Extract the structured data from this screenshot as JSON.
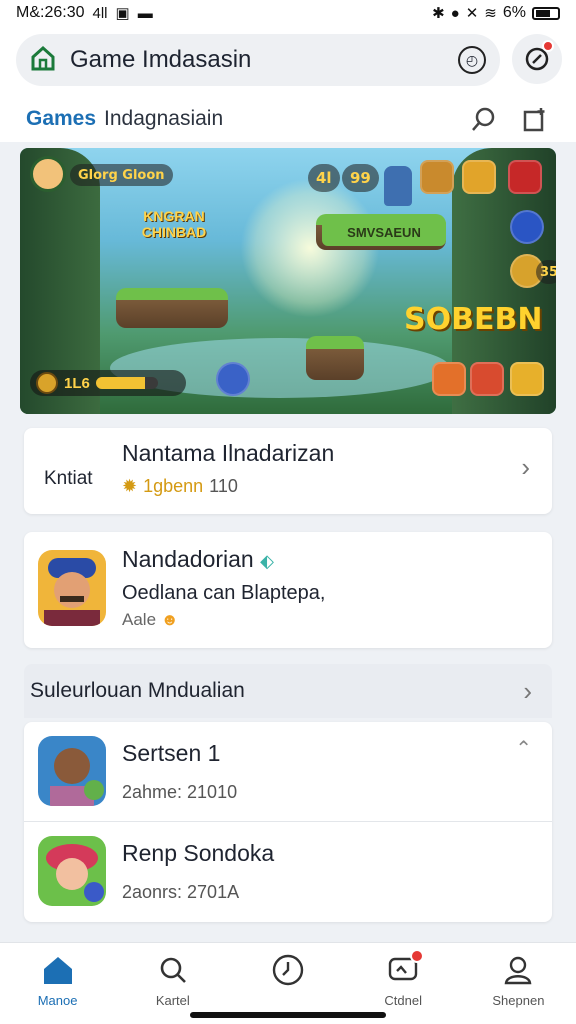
{
  "status_bar": {
    "time": "M&:26:30",
    "left_icons": [
      "4ll",
      "▣",
      "▬"
    ],
    "battery_text": "6%"
  },
  "top_bar": {
    "title": "Game Imdasasin"
  },
  "sub_header": {
    "games_label": "Games",
    "title": "Indagnasiain"
  },
  "banner": {
    "hud_name": "Glorg Gloon",
    "banner_title": "KNGRAN CHINBAD",
    "chip_a": "4l",
    "chip_b": "99",
    "side_count": "35",
    "sign_text": "SMVSAEUN",
    "score_text": "SOBEBN",
    "power_level": "1L6",
    "power_fill": 0.8
  },
  "card_1": {
    "prefix": "Kntiat",
    "title": "Nantama Ilnadarizan",
    "meta_gold": "1gbenn",
    "meta_count": "110"
  },
  "card_2": {
    "title": "Nandadorian",
    "desc": "Oedlana can Blaptepa,",
    "sub": "Aale"
  },
  "section": {
    "title": "Suleurlouan Mndualian"
  },
  "list": [
    {
      "title": "Sertsen 1",
      "sub": "2ahme: 21010"
    },
    {
      "title": "Renp Sondoka",
      "sub": "2aonrs: 2701A"
    }
  ],
  "nav": [
    {
      "label": "Manoe",
      "active": true
    },
    {
      "label": "Kartel",
      "active": false
    },
    {
      "label": "",
      "active": false
    },
    {
      "label": "Ctdnel",
      "active": false
    },
    {
      "label": "Shepnen",
      "active": false
    }
  ],
  "colors": {
    "accent": "#1c6fb4",
    "alert": "#e53935",
    "gold": "#d49a13"
  }
}
